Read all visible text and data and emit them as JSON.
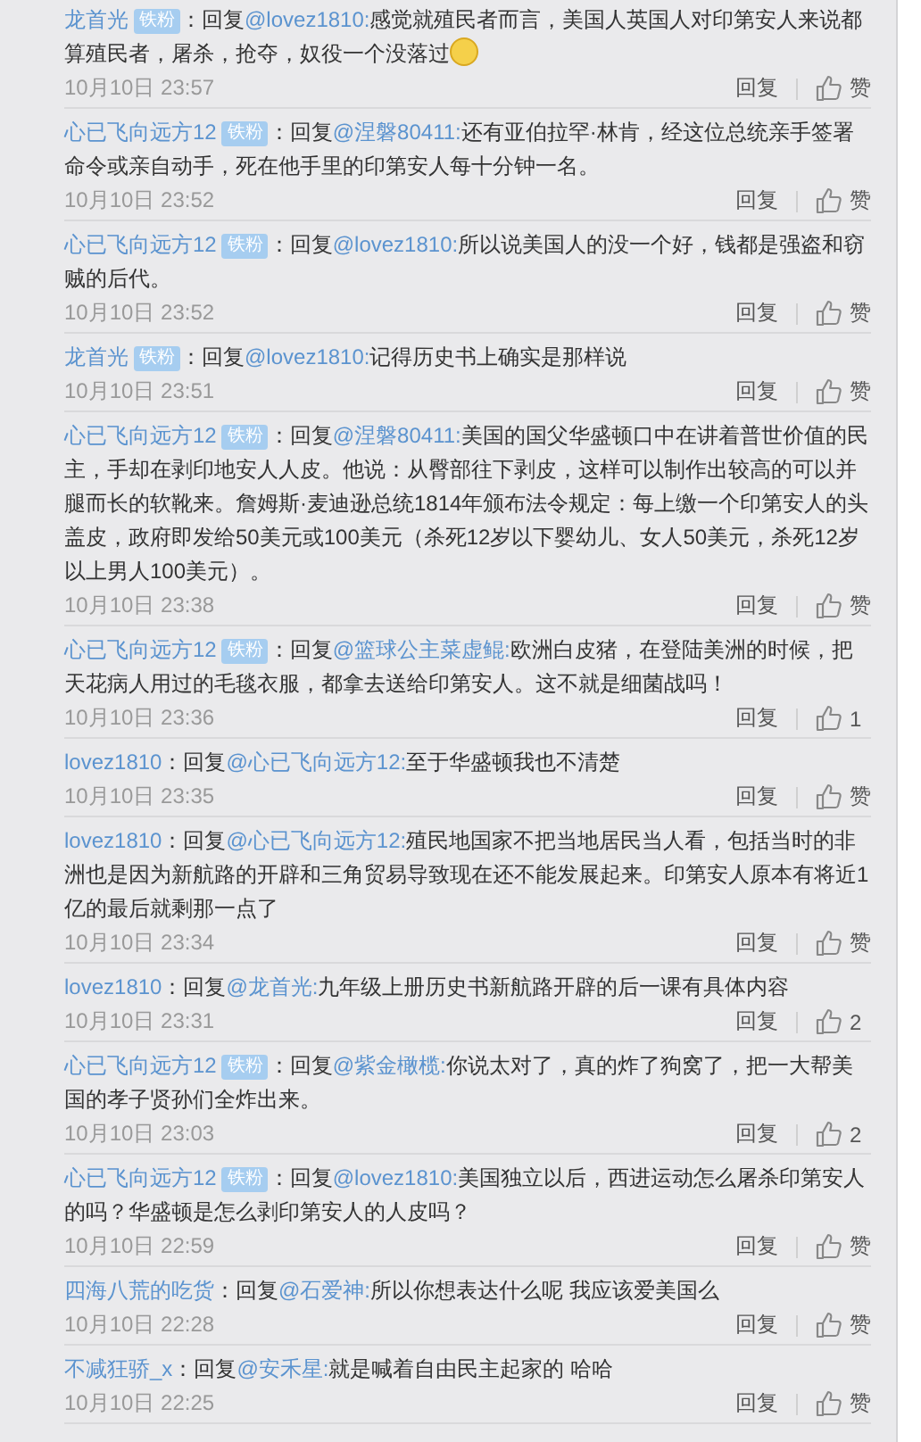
{
  "comments": [
    {
      "user": "龙首光",
      "badge": "铁粉",
      "prefix": "：回复",
      "mention": "@lovez1810:",
      "body": "感觉就殖民者而言，美国人英国人对印第安人来说都算殖民者，屠杀，抢夺，奴役一个没落过",
      "emoji": true,
      "time": "10月10日 23:57",
      "reply": "回复",
      "like": "赞"
    },
    {
      "user": "心已飞向远方12",
      "badge": "铁粉",
      "prefix": "：回复",
      "mention": "@涅磐80411:",
      "body": "还有亚伯拉罕·林肯，经这位总统亲手签署命令或亲自动手，死在他手里的印第安人每十分钟一名。",
      "emoji": false,
      "time": "10月10日 23:52",
      "reply": "回复",
      "like": "赞"
    },
    {
      "user": "心已飞向远方12",
      "badge": "铁粉",
      "prefix": "：回复",
      "mention": "@lovez1810:",
      "body": "所以说美国人的没一个好，钱都是强盗和窃贼的后代。",
      "emoji": false,
      "time": "10月10日 23:52",
      "reply": "回复",
      "like": "赞"
    },
    {
      "user": "龙首光",
      "badge": "铁粉",
      "prefix": "：回复",
      "mention": "@lovez1810:",
      "body": "记得历史书上确实是那样说",
      "emoji": false,
      "time": "10月10日 23:51",
      "reply": "回复",
      "like": "赞"
    },
    {
      "user": "心已飞向远方12",
      "badge": "铁粉",
      "prefix": "：回复",
      "mention": "@涅磐80411:",
      "body": "美国的国父华盛顿口中在讲着普世价值的民主，手却在剥印地安人人皮。他说：从臀部往下剥皮，这样可以制作出较高的可以并腿而长的软靴来。詹姆斯·麦迪逊总统1814年颁布法令规定：每上缴一个印第安人的头盖皮，政府即发给50美元或100美元（杀死12岁以下婴幼儿、女人50美元，杀死12岁以上男人100美元）。",
      "emoji": false,
      "time": "10月10日 23:38",
      "reply": "回复",
      "like": "赞"
    },
    {
      "user": "心已飞向远方12",
      "badge": "铁粉",
      "prefix": "：回复",
      "mention": "@篮球公主菜虚鲲:",
      "body": "欧洲白皮猪，在登陆美洲的时候，把天花病人用过的毛毯衣服，都拿去送给印第安人。这不就是细菌战吗！",
      "emoji": false,
      "time": "10月10日 23:36",
      "reply": "回复",
      "like": "1"
    },
    {
      "user": "lovez1810",
      "prefix": "：回复",
      "mention": "@心已飞向远方12:",
      "body": "至于华盛顿我也不清楚",
      "emoji": false,
      "time": "10月10日 23:35",
      "reply": "回复",
      "like": "赞"
    },
    {
      "user": "lovez1810",
      "prefix": "：回复",
      "mention": "@心已飞向远方12:",
      "body": "殖民地国家不把当地居民当人看，包括当时的非洲也是因为新航路的开辟和三角贸易导致现在还不能发展起来。印第安人原本有将近1亿的最后就剩那一点了",
      "emoji": false,
      "time": "10月10日 23:34",
      "reply": "回复",
      "like": "赞"
    },
    {
      "user": "lovez1810",
      "prefix": "：回复",
      "mention": "@龙首光:",
      "body": "九年级上册历史书新航路开辟的后一课有具体内容",
      "emoji": false,
      "time": "10月10日 23:31",
      "reply": "回复",
      "like": "2"
    },
    {
      "user": "心已飞向远方12",
      "badge": "铁粉",
      "prefix": "：回复",
      "mention": "@紫金橄榄:",
      "body": "你说太对了，真的炸了狗窝了，把一大帮美国的孝子贤孙们全炸出来。",
      "emoji": false,
      "time": "10月10日 23:03",
      "reply": "回复",
      "like": "2"
    },
    {
      "user": "心已飞向远方12",
      "badge": "铁粉",
      "prefix": "：回复",
      "mention": "@lovez1810:",
      "body": "美国独立以后，西进运动怎么屠杀印第安人的吗？华盛顿是怎么剥印第安人的人皮吗？",
      "emoji": false,
      "time": "10月10日 22:59",
      "reply": "回复",
      "like": "赞"
    },
    {
      "user": "四海八荒的吃货",
      "prefix": "：回复",
      "mention": "@石爱神:",
      "body": "所以你想表达什么呢  我应该爱美国么",
      "emoji": false,
      "time": "10月10日 22:28",
      "reply": "回复",
      "like": "赞"
    },
    {
      "user": "不减狂骄_x",
      "prefix": "：回复",
      "mention": "@安禾星:",
      "body": "就是喊着自由民主起家的 哈哈",
      "emoji": false,
      "time": "10月10日 22:25",
      "reply": "回复",
      "like": "赞"
    }
  ]
}
